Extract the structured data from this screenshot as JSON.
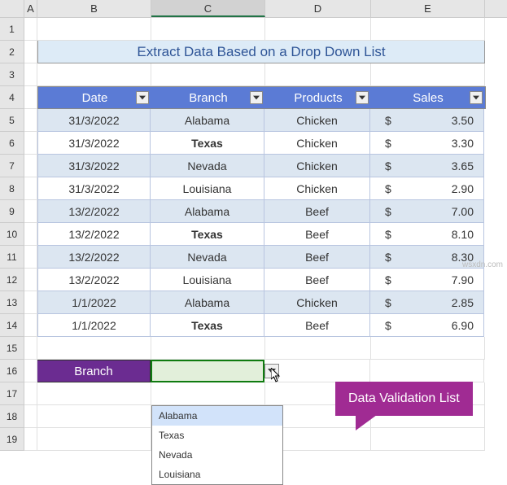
{
  "columns": [
    "A",
    "B",
    "C",
    "D",
    "E"
  ],
  "rows": [
    "1",
    "2",
    "3",
    "4",
    "5",
    "6",
    "7",
    "8",
    "9",
    "10",
    "11",
    "12",
    "13",
    "14",
    "15",
    "16",
    "17",
    "18",
    "19"
  ],
  "title": "Extract Data Based on a Drop Down List",
  "headers": {
    "date": "Date",
    "branch": "Branch",
    "products": "Products",
    "sales": "Sales"
  },
  "currency": "$",
  "data": [
    {
      "date": "31/3/2022",
      "branch": "Alabama",
      "product": "Chicken",
      "sales": "3.50",
      "bold": false
    },
    {
      "date": "31/3/2022",
      "branch": "Texas",
      "product": "Chicken",
      "sales": "3.30",
      "bold": true
    },
    {
      "date": "31/3/2022",
      "branch": "Nevada",
      "product": "Chicken",
      "sales": "3.65",
      "bold": false
    },
    {
      "date": "31/3/2022",
      "branch": "Louisiana",
      "product": "Chicken",
      "sales": "2.90",
      "bold": false
    },
    {
      "date": "13/2/2022",
      "branch": "Alabama",
      "product": "Beef",
      "sales": "7.00",
      "bold": false
    },
    {
      "date": "13/2/2022",
      "branch": "Texas",
      "product": "Beef",
      "sales": "8.10",
      "bold": true
    },
    {
      "date": "13/2/2022",
      "branch": "Nevada",
      "product": "Beef",
      "sales": "8.30",
      "bold": false
    },
    {
      "date": "13/2/2022",
      "branch": "Louisiana",
      "product": "Beef",
      "sales": "7.90",
      "bold": false
    },
    {
      "date": "1/1/2022",
      "branch": "Alabama",
      "product": "Chicken",
      "sales": "2.85",
      "bold": false
    },
    {
      "date": "1/1/2022",
      "branch": "Texas",
      "product": "Beef",
      "sales": "6.90",
      "bold": true
    }
  ],
  "branch_label": "Branch",
  "dropdown_items": [
    "Alabama",
    "Texas",
    "Nevada",
    "Louisiana"
  ],
  "callout_text": "Data Validation List",
  "watermark": "wsxdn.com"
}
